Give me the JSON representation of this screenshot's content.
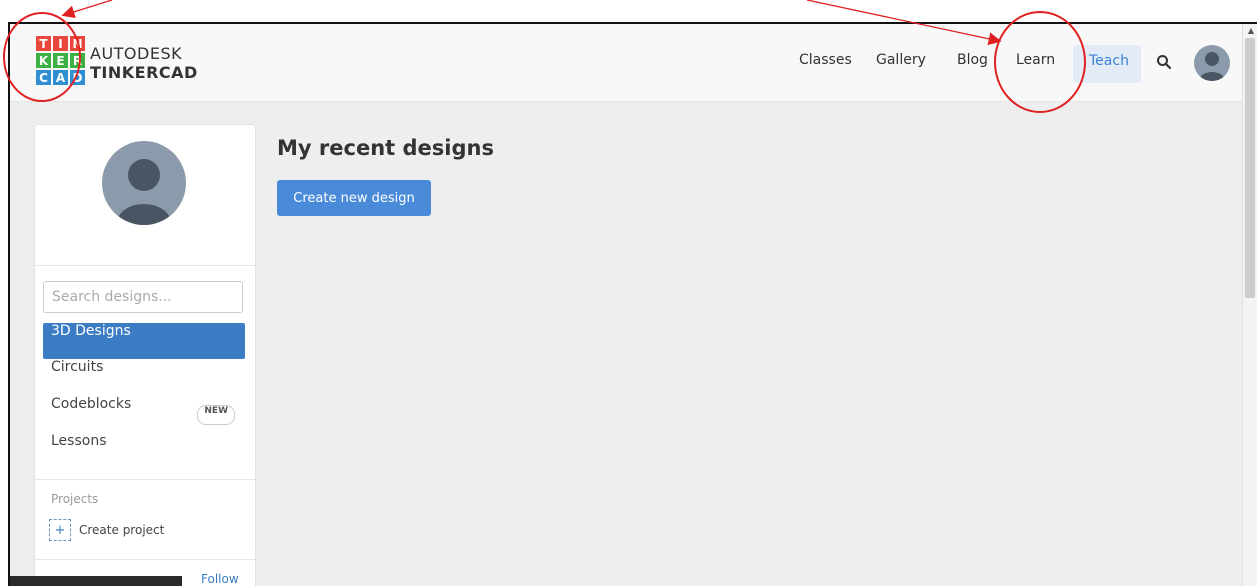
{
  "brand": {
    "logo_letters": [
      "T",
      "I",
      "N",
      "K",
      "E",
      "R",
      "C",
      "A",
      "D"
    ],
    "logo_colors": [
      "#e8483b",
      "#e8483b",
      "#e8483b",
      "#3cb043",
      "#3cb043",
      "#3cb043",
      "#2f8fd1",
      "#2f8fd1",
      "#2f8fd1"
    ],
    "line1": "AUTODESK",
    "line2": "TINKERCAD"
  },
  "nav": {
    "items": [
      "Classes",
      "Gallery",
      "Blog",
      "Learn",
      "Teach"
    ],
    "active": "Teach",
    "search_icon": "search-icon",
    "avatar_icon": "user-avatar-icon"
  },
  "sidebar": {
    "search_placeholder": "Search designs...",
    "items": [
      {
        "label": "3D Designs",
        "active": true
      },
      {
        "label": "Circuits"
      },
      {
        "label": "Codeblocks",
        "badge": "NEW"
      },
      {
        "label": "Lessons"
      }
    ],
    "projects_label": "Projects",
    "create_project_label": "Create project",
    "follow_label": "Follow"
  },
  "main": {
    "title": "My recent designs",
    "create_button": "Create new design"
  },
  "annotation": {
    "color": "#e02020",
    "targets": [
      "logo",
      "learn-nav"
    ]
  },
  "colors": {
    "accent": "#3b7cc4",
    "button": "#4a8bd9",
    "background": "#eeeeef"
  }
}
